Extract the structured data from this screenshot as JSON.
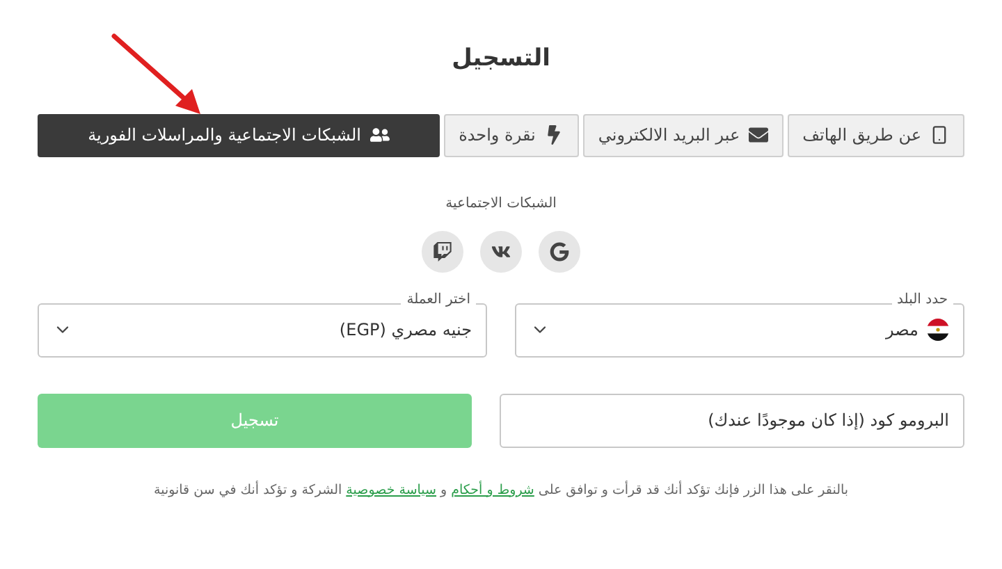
{
  "title": "التسجيل",
  "tabs": [
    {
      "label": "عن طريق الهاتف",
      "kind": "phone",
      "selected": false
    },
    {
      "label": "عبر البريد الالكتروني",
      "kind": "email",
      "selected": false
    },
    {
      "label": "نقرة واحدة",
      "kind": "oneclick",
      "selected": false
    },
    {
      "label": "الشبكات الاجتماعية والمراسلات الفورية",
      "kind": "social",
      "selected": true
    }
  ],
  "social": {
    "heading": "الشبكات الاجتماعية",
    "networks": [
      {
        "kind": "google"
      },
      {
        "kind": "vk"
      },
      {
        "kind": "twitch"
      }
    ]
  },
  "country": {
    "label": "حدد البلد",
    "value": "مصر"
  },
  "currency": {
    "label": "اختر العملة",
    "value": "جنيه مصري (EGP)"
  },
  "promo": {
    "placeholder": "البرومو كود (إذا كان موجودًا عندك)"
  },
  "submit": {
    "label": "تسجيل",
    "disabled": true
  },
  "agreement": {
    "before": "بالنقر على هذا الزر فإنك تؤكد أنك قد قرأت و توافق على ",
    "terms_link": "شروط و أحكام",
    "middle": " و ",
    "privacy_link": "سياسة خصوصية",
    "after": " الشركة و تؤكد أنك في سن قانونية"
  }
}
